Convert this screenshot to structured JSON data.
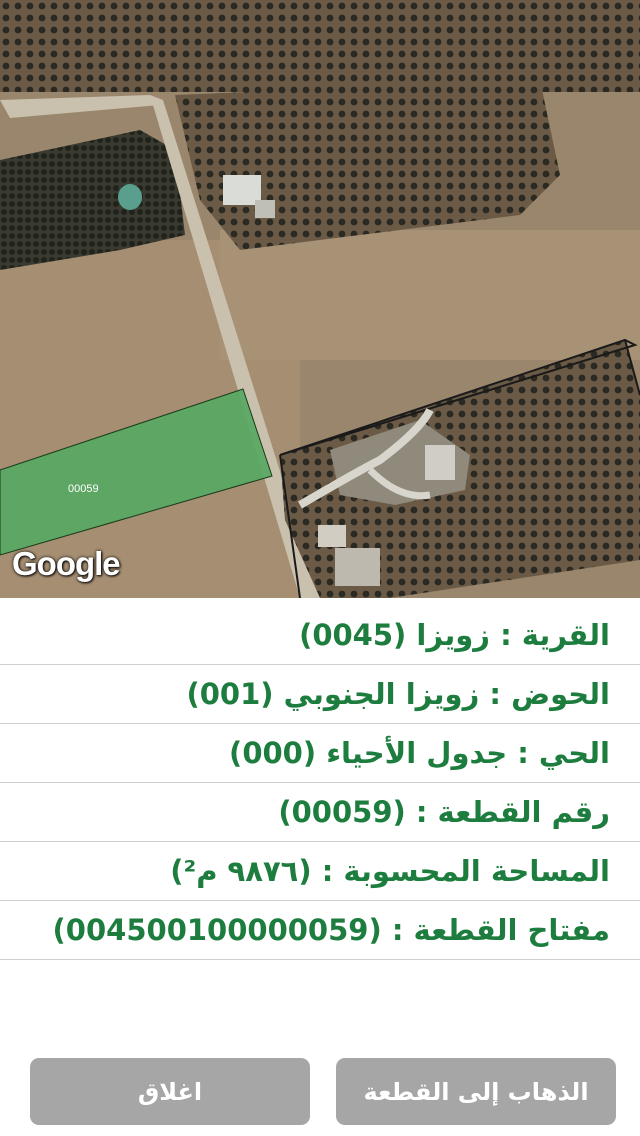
{
  "map": {
    "parcel_label": "00059",
    "logo_text": "Google",
    "parcel_color": "#58a862"
  },
  "details": [
    {
      "text": "القرية : زويزا (0045)"
    },
    {
      "text": "الحوض : زويزا الجنوبي (001)"
    },
    {
      "text": "الحي : جدول الأحياء (000)"
    },
    {
      "text": "رقم القطعة : (00059)"
    },
    {
      "text": "المساحة المحسوبة : (٩٨٧٦ م²)"
    },
    {
      "text": "مفتاح القطعة : (004500100000059)"
    }
  ],
  "buttons": {
    "close_label": "اغلاق",
    "goto_label": "الذهاب إلى القطعة"
  },
  "colors": {
    "text_green": "#1d7d3e",
    "button_gray": "#a6a6a6"
  }
}
